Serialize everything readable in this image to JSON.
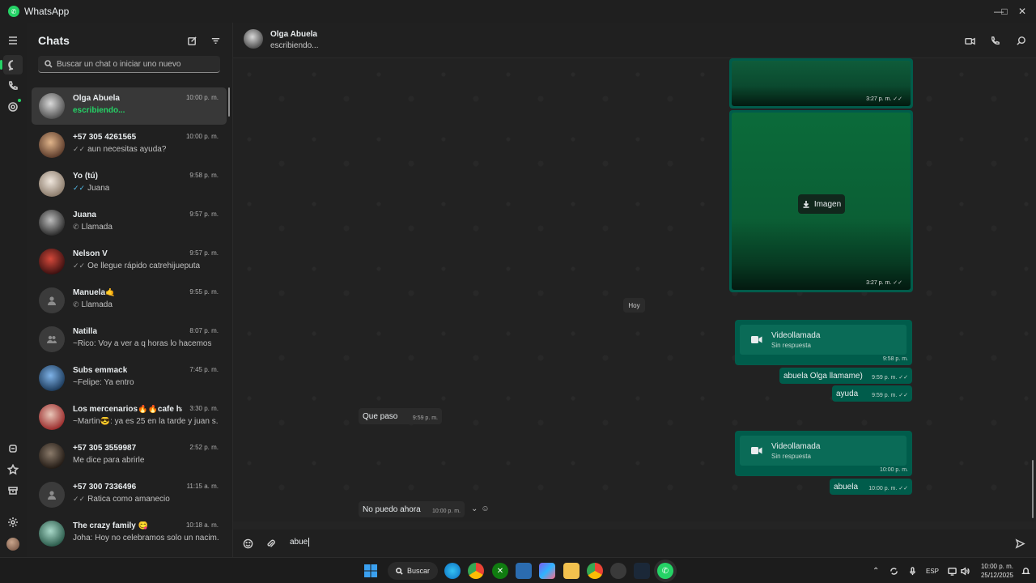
{
  "window": {
    "title": "WhatsApp"
  },
  "sidebar": {
    "title": "Chats",
    "search_placeholder": "Buscar un chat o iniciar uno nuevo",
    "chats": [
      {
        "name": "Olga Abuela",
        "time": "10:00 p. m.",
        "preview": "escribiendo...",
        "typing": true,
        "tick": "",
        "avatar": "photo-gray"
      },
      {
        "name": "+57 305 4261565",
        "time": "10:00 p. m.",
        "preview": "aun necesitas ayuda?",
        "tick": "sent",
        "avatar": "photo-warm"
      },
      {
        "name": "Yo (tú)",
        "time": "9:58 p. m.",
        "preview": "Juana",
        "tick": "read",
        "avatar": "photo-light"
      },
      {
        "name": "Juana",
        "time": "9:57 p. m.",
        "preview": "Llamada",
        "tick": "call",
        "avatar": "photo-dark"
      },
      {
        "name": "Nelson V",
        "time": "9:57 p. m.",
        "preview": "Oe llegue rápido catrehijueputa",
        "tick": "sent",
        "avatar": "photo-red"
      },
      {
        "name": "Manuela🤙",
        "time": "9:55 p. m.",
        "preview": "Llamada",
        "tick": "call",
        "avatar": "placeholder"
      },
      {
        "name": "Natilla",
        "time": "8:07 p. m.",
        "preview": "~Rico: Voy a ver a q horas lo hacemos",
        "tick": "",
        "avatar": "group"
      },
      {
        "name": "Subs emmack",
        "time": "7:45 p. m.",
        "preview": "~Felipe: Ya entro",
        "tick": "",
        "avatar": "photo-blue"
      },
      {
        "name": "Los mercenarios🔥🔥cafe ha...",
        "time": "3:30 p. m.",
        "preview": "~Martin😎: ya es 25 en la tarde y juan s...",
        "tick": "",
        "avatar": "photo-red2"
      },
      {
        "name": "+57 305 3559987",
        "time": "2:52 p. m.",
        "preview": "Me dice para abrirle",
        "tick": "",
        "avatar": "photo-dark2"
      },
      {
        "name": "+57 300 7336496",
        "time": "11:15 a. m.",
        "preview": "Ratica como amanecio",
        "tick": "sent",
        "avatar": "placeholder"
      },
      {
        "name": "The crazy family 😋",
        "time": "10:18 a. m.",
        "preview": "Joha: Hoy no celebramos solo un nacim...",
        "tick": "",
        "avatar": "photo-teal"
      }
    ]
  },
  "conversation": {
    "name": "Olga Abuela",
    "status": "escribiendo...",
    "images": [
      {
        "time": "3:27 p. m."
      },
      {
        "time": "3:27 p. m.",
        "download_label": "Imagen"
      }
    ],
    "date_chip": "Hoy",
    "messages": [
      {
        "kind": "call",
        "title": "Videollamada",
        "subtitle": "Sin respuesta",
        "time": "9:58 p. m."
      },
      {
        "kind": "out",
        "text": "abuela Olga llamame)",
        "time": "9:59 p. m."
      },
      {
        "kind": "out",
        "text": "ayuda",
        "time": "9:59 p. m."
      },
      {
        "kind": "in",
        "text": "Que paso",
        "time": "9:59 p. m."
      },
      {
        "kind": "call",
        "title": "Videollamada",
        "subtitle": "Sin respuesta",
        "time": "10:00 p. m."
      },
      {
        "kind": "out",
        "text": "abuela",
        "time": "10:00 p. m."
      },
      {
        "kind": "in",
        "text": "No puedo ahora",
        "time": "10:00 p. m."
      }
    ],
    "composer_value": "abue"
  },
  "taskbar": {
    "search_label": "Buscar",
    "language": "ESP",
    "clock_time": "10:00 p. m.",
    "clock_date": "25/12/2025"
  },
  "colors": {
    "accent": "#25d366",
    "outgoing_bubble": "#005c4b",
    "incoming_bubble": "#2b2b2b",
    "read_tick": "#53bdeb"
  }
}
